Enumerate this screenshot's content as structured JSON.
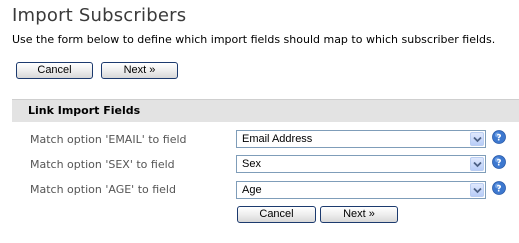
{
  "page": {
    "title": "Import Subscribers",
    "intro": "Use the form below to define which import fields should map to which subscriber fields."
  },
  "top_actions": {
    "cancel_label": "Cancel",
    "next_label": "Next »"
  },
  "link_fields": {
    "section_title": "Link Import Fields",
    "rows": [
      {
        "label": "Match option 'EMAIL' to field",
        "selected": "Email Address",
        "help_icon": "help-icon"
      },
      {
        "label": "Match option 'SEX' to field",
        "selected": "Sex",
        "help_icon": "help-icon"
      },
      {
        "label": "Match option 'AGE' to field",
        "selected": "Age",
        "help_icon": "help-icon"
      }
    ]
  },
  "bottom_actions": {
    "cancel_label": "Cancel",
    "next_label": "Next »"
  },
  "colors": {
    "section_header_bg": "#e3e3e3",
    "button_border": "#1c3a6e",
    "select_border": "#7f9db9",
    "help_icon_blue": "#3d78cf"
  }
}
